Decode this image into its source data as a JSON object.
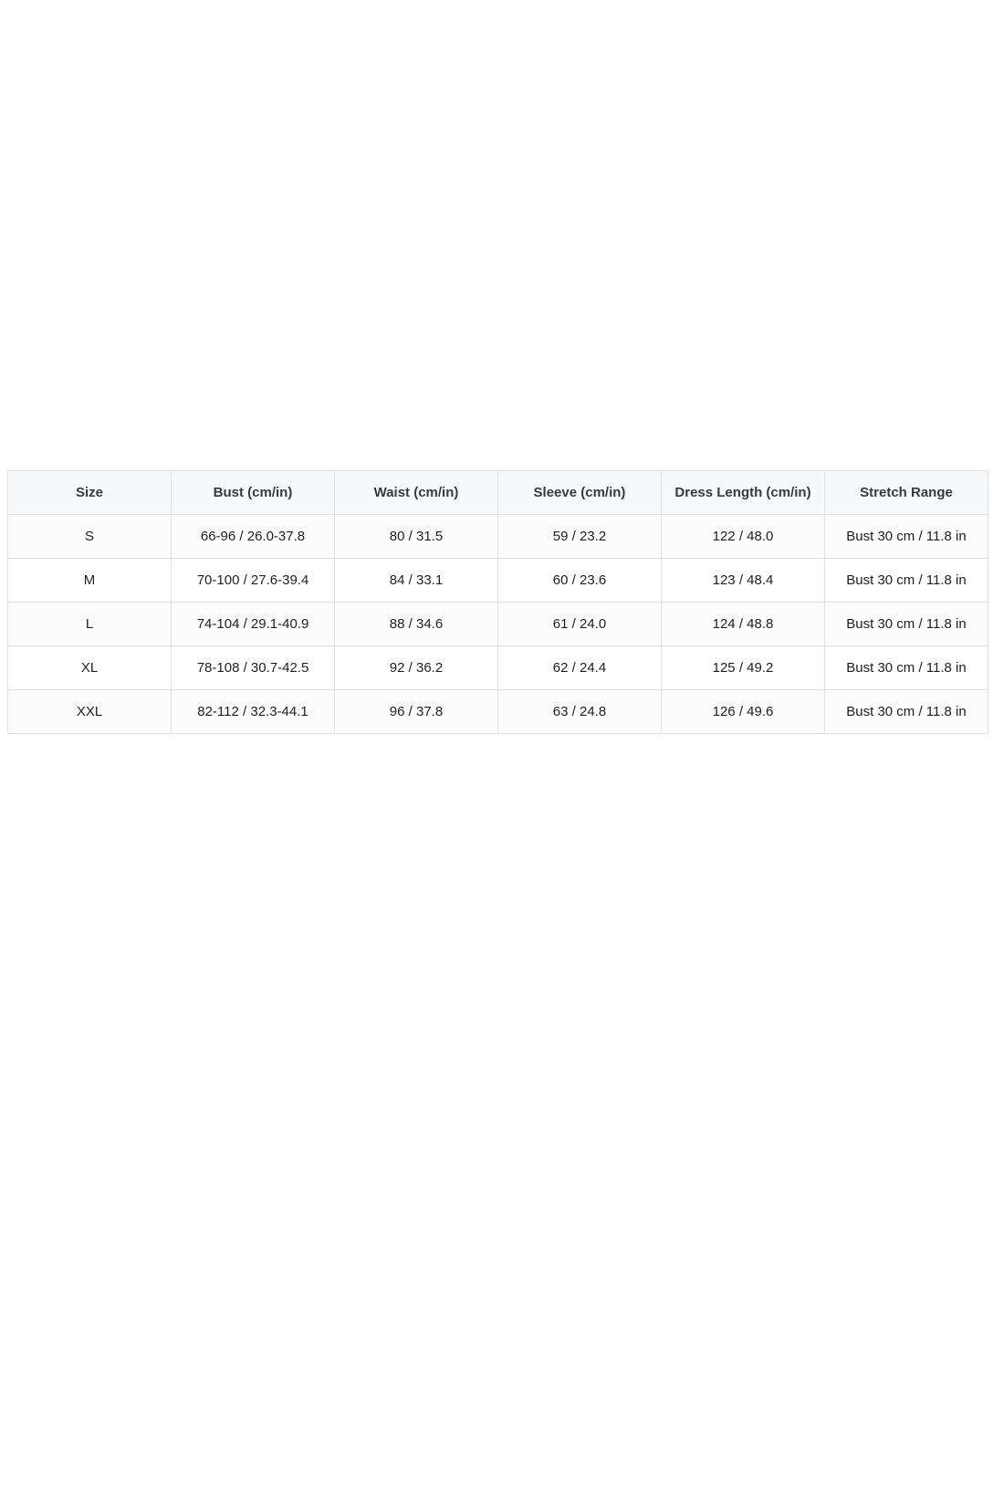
{
  "size_chart": {
    "headers": [
      "Size",
      "Bust (cm/in)",
      "Waist (cm/in)",
      "Sleeve (cm/in)",
      "Dress Length (cm/in)",
      "Stretch Range"
    ],
    "rows": [
      [
        "S",
        "66-96 / 26.0-37.8",
        "80 / 31.5",
        "59 / 23.2",
        "122 / 48.0",
        "Bust 30 cm / 11.8 in"
      ],
      [
        "M",
        "70-100 / 27.6-39.4",
        "84 / 33.1",
        "60 / 23.6",
        "123 / 48.4",
        "Bust 30 cm / 11.8 in"
      ],
      [
        "L",
        "74-104 / 29.1-40.9",
        "88 / 34.6",
        "61 / 24.0",
        "124 / 48.8",
        "Bust 30 cm / 11.8 in"
      ],
      [
        "XL",
        "78-108 / 30.7-42.5",
        "92 / 36.2",
        "62 / 24.4",
        "125 / 49.2",
        "Bust 30 cm / 11.8 in"
      ],
      [
        "XXL",
        "82-112 / 32.3-44.1",
        "96 / 37.8",
        "63 / 24.8",
        "126 / 49.6",
        "Bust 30 cm / 11.8 in"
      ]
    ]
  }
}
